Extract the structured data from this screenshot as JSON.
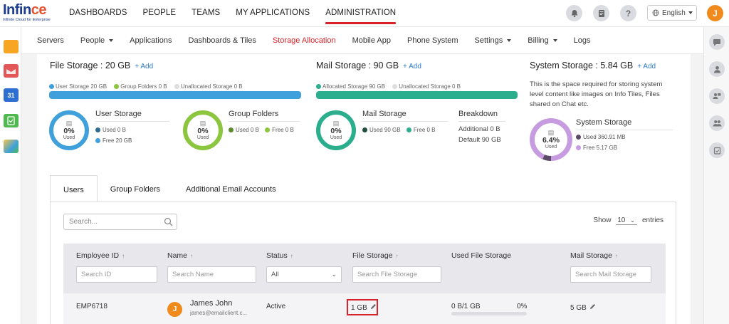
{
  "header": {
    "logo_name_part1": "Infin",
    "logo_name_part2": "ce",
    "logo_tagline": "Infinite Cloud for Enterprise",
    "nav": [
      "DASHBOARDS",
      "PEOPLE",
      "TEAMS",
      "MY APPLICATIONS",
      "ADMINISTRATION"
    ],
    "active_nav": "ADMINISTRATION",
    "icons": [
      "bell-icon",
      "notes-icon",
      "help-icon"
    ],
    "language": "English",
    "user_initial": "J"
  },
  "subnav": {
    "items": [
      "Servers",
      "People",
      "Applications",
      "Dashboards & Tiles",
      "Storage Allocation",
      "Mobile App",
      "Phone System",
      "Settings",
      "Billing",
      "Logs"
    ],
    "dropdown_items": [
      "People",
      "Settings",
      "Billing"
    ],
    "active": "Storage Allocation"
  },
  "file_storage": {
    "title": "File Storage : 20 GB",
    "add": "+ Add",
    "legend": [
      "User Storage 20 GB",
      "Group Folders 0 B",
      "Unallocated Storage 0 B"
    ],
    "user_storage": {
      "title": "User Storage",
      "pct": "0%",
      "used_label": "Used",
      "used": "Used 0 B",
      "free": "Free 20 GB"
    },
    "group_folders": {
      "title": "Group Folders",
      "pct": "0%",
      "used_label": "Used",
      "used": "Used 0 B",
      "free": "Free 0 B"
    }
  },
  "mail_storage": {
    "title": "Mail Storage : 90 GB",
    "add": "+ Add",
    "legend": [
      "Allocated Storage 90 GB",
      "Unallocated Storage 0 B"
    ],
    "block": {
      "title": "Mail Storage",
      "pct": "0%",
      "used_label": "Used",
      "used": "Used 90 GB",
      "free": "Free 0 B"
    },
    "breakdown": {
      "title": "Breakdown",
      "additional": "Additional 0 B",
      "default": "Default 90 GB"
    }
  },
  "system_storage": {
    "title": "System Storage : 5.84 GB",
    "add": "+ Add",
    "description": [
      "This is the space required for storing system",
      "level content like images on Info Tiles, Files",
      "shared on Chat etc."
    ],
    "block": {
      "title": "System Storage",
      "pct": "6.4%",
      "used_label": "Used",
      "used": "Used 360.91 MB",
      "free": "Free 5.17 GB",
      "used_fraction": 0.064
    }
  },
  "tabs": [
    "Users",
    "Group Folders",
    "Additional Email Accounts"
  ],
  "active_tab": "Users",
  "table": {
    "search_placeholder": "Search...",
    "show_label": "Show",
    "show_value": "10",
    "entries_label": "entries",
    "columns": [
      "Employee ID",
      "Name",
      "Status",
      "File Storage",
      "Used File Storage",
      "Mail Storage"
    ],
    "filters": {
      "employee_id": "Search ID",
      "name": "Search Name",
      "status": "All",
      "file_storage": "Search File Storage",
      "mail_storage": "Search Mail Storage"
    },
    "rows": [
      {
        "employee_id": "EMP6718",
        "initial": "J",
        "name": "James John",
        "email": "james@emailclient.c...",
        "status": "Active",
        "file_storage": "1 GB",
        "used_file_storage": "0 B/1 GB",
        "used_pct": "0%",
        "used_fraction": 0,
        "mail_storage": "5 GB"
      }
    ]
  },
  "colors": {
    "accent_red": "#d8232a",
    "blue": "#3fa0dc",
    "green": "#8cc63f",
    "teal": "#2bae8e",
    "purple": "#c79be0",
    "avatar_orange": "#f08a1c"
  }
}
